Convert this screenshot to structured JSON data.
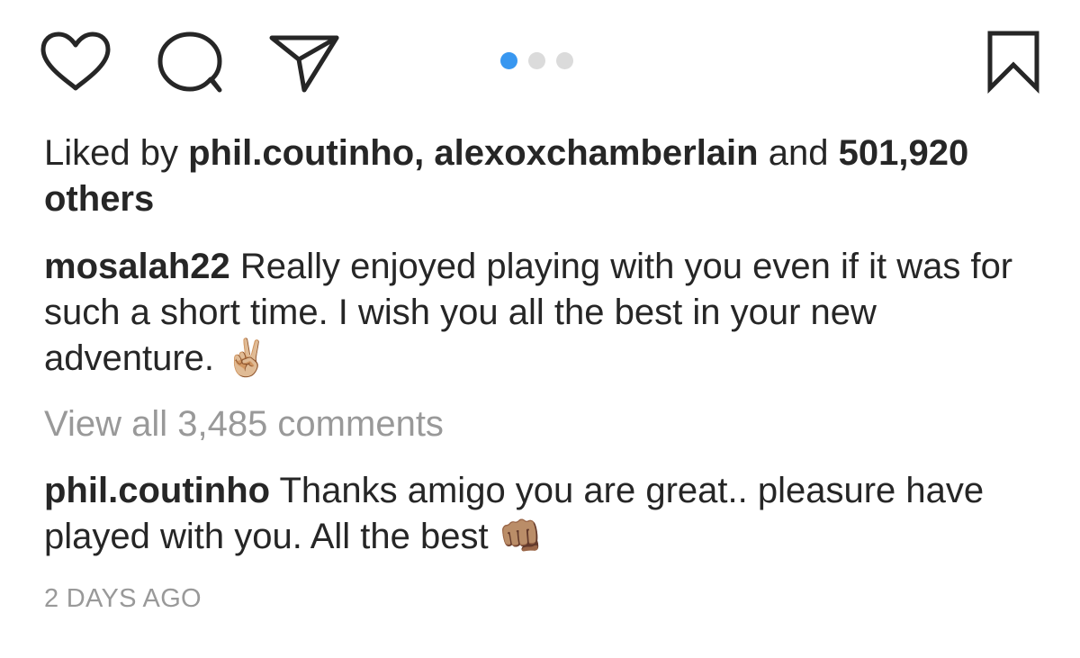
{
  "action_bar": {
    "icons": {
      "like": "heart-icon",
      "comment": "comment-icon",
      "share": "paper-plane-icon",
      "save": "bookmark-icon"
    },
    "carousel": {
      "total": 3,
      "active_index": 0,
      "active_color": "#3897f0",
      "inactive_color": "#dbdbdb"
    }
  },
  "likes": {
    "prefix": "Liked by",
    "user1": "phil.coutinho",
    "separator": ",",
    "user2": "alexoxchamberlain",
    "conjunction": "and",
    "others_count": "501,920 others"
  },
  "caption": {
    "username": "mosalah22",
    "text": "Really enjoyed playing with you even if it was for such a short time. I wish you all the best in your new adventure.",
    "emoji": "✌🏼"
  },
  "view_all_comments": "View all 3,485 comments",
  "reply": {
    "username": "phil.coutinho",
    "text": "Thanks amigo you are great.. pleasure have played with you. All the best",
    "emoji": "👊🏽"
  },
  "timestamp": "2 DAYS AGO",
  "colors": {
    "text": "#262626",
    "muted": "#999999",
    "accent": "#3897f0"
  }
}
